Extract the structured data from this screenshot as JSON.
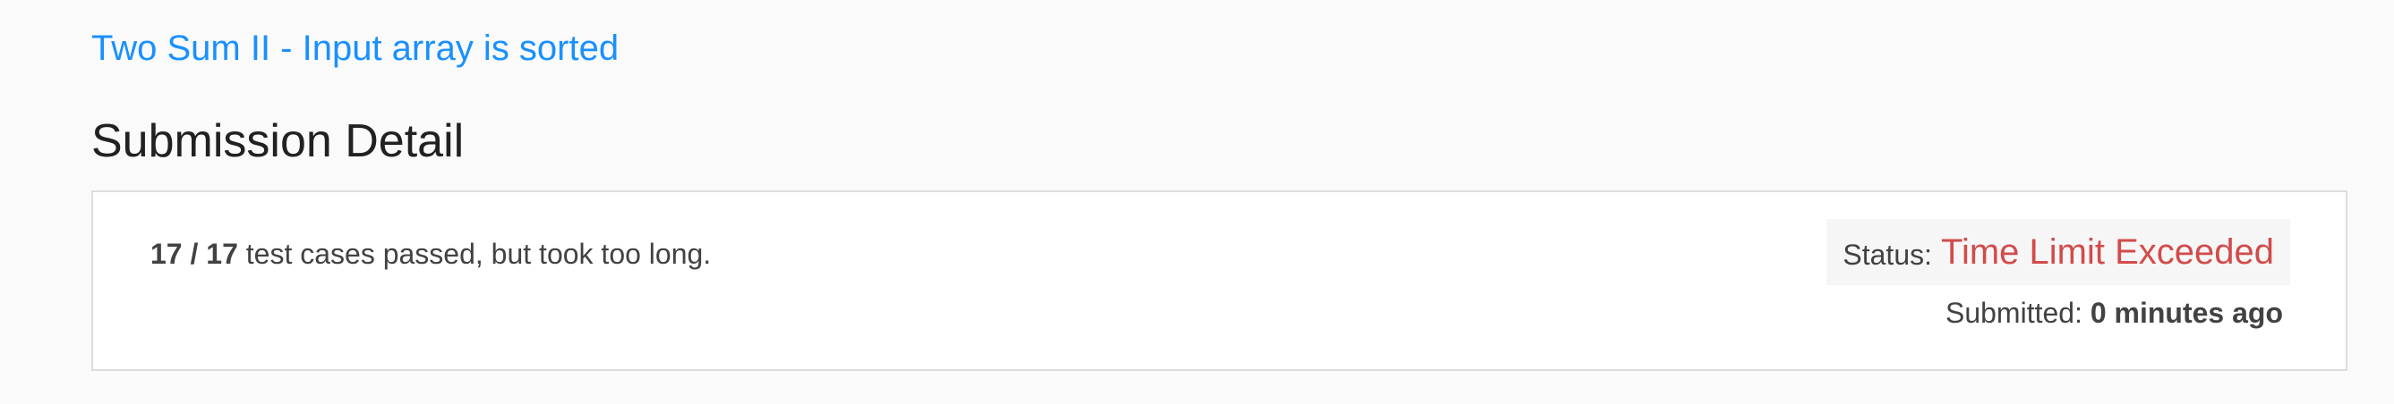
{
  "problem": {
    "title": "Two Sum II - Input array is sorted"
  },
  "page": {
    "heading": "Submission Detail"
  },
  "submission": {
    "passed_count": "17 / 17",
    "result_text": " test cases passed, but took too long.",
    "status_label": "Status:",
    "status_value": "Time Limit Exceeded",
    "submitted_label": "Submitted:",
    "submitted_time": "0 minutes ago"
  },
  "colors": {
    "link": "#1a90ff",
    "status_error": "#d24b4b",
    "heading": "#212121"
  }
}
